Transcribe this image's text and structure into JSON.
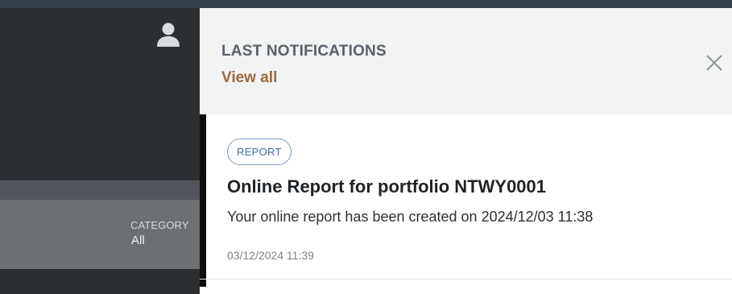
{
  "background": {
    "filter": {
      "label": "CATEGORY",
      "value": "All"
    }
  },
  "notifications_panel": {
    "title": "LAST NOTIFICATIONS",
    "view_all": "View all",
    "items": [
      {
        "category": "REPORT",
        "title": "Online Report for portfolio NTWY0001",
        "body": "Your online report has been created on 2024/12/03 11:38",
        "timestamp": "03/12/2024 11:39"
      }
    ]
  },
  "colors": {
    "panel_bg": "#ffffff",
    "header_bg": "#f2f3f3",
    "accent_link": "#9c6a3c",
    "badge_border": "#7a9ec6",
    "badge_text": "#3d6fa8",
    "app_bg": "#2b2f33"
  },
  "icons": {
    "user": "user-icon",
    "close": "close-icon"
  }
}
